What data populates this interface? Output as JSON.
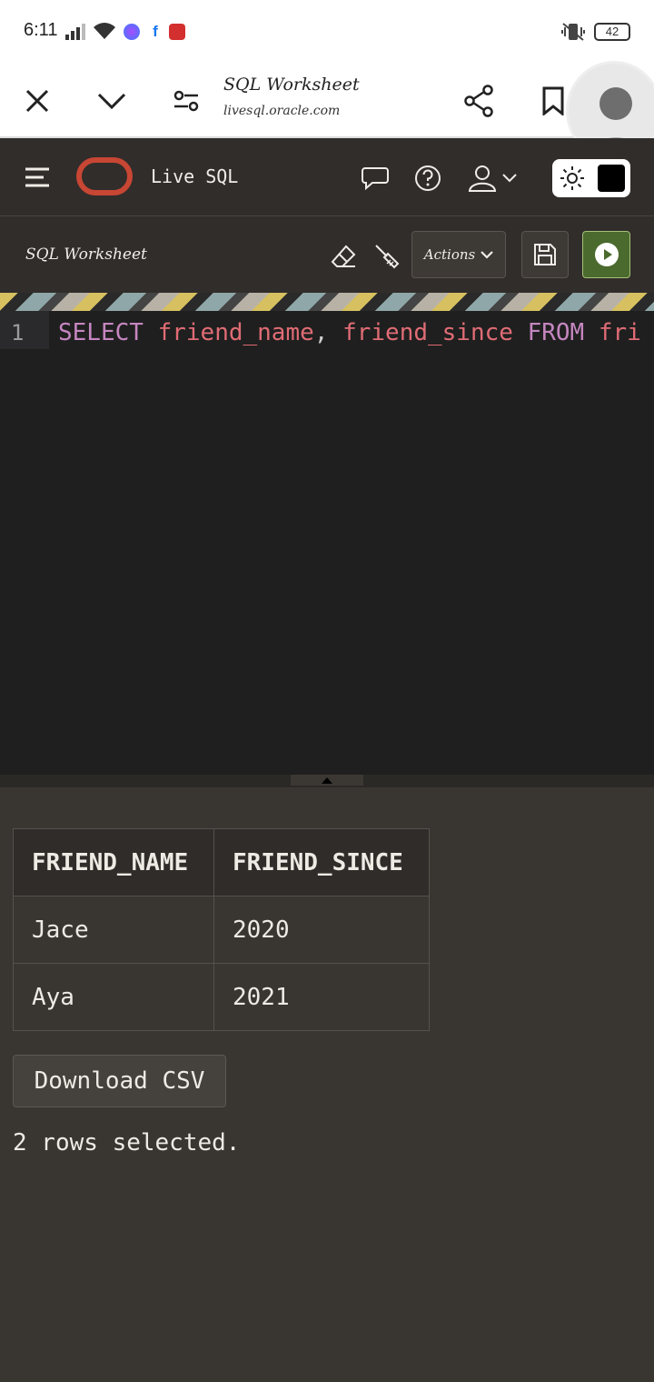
{
  "status_bar": {
    "time": "6:11",
    "battery": "42"
  },
  "browser": {
    "page_title": "SQL Worksheet",
    "url": "livesql.oracle.com"
  },
  "app": {
    "title": "Live SQL"
  },
  "worksheet": {
    "title": "SQL Worksheet",
    "actions_label": "Actions"
  },
  "editor": {
    "line_number": "1",
    "code_tokens": [
      "SELECT",
      " friend_name",
      ",",
      " friend_since",
      " FROM",
      " fri"
    ]
  },
  "results": {
    "columns": [
      "FRIEND_NAME",
      "FRIEND_SINCE"
    ],
    "rows": [
      [
        "Jace",
        "2020"
      ],
      [
        "Aya",
        "2021"
      ]
    ],
    "download_label": "Download CSV",
    "row_count_text": "2 rows selected."
  },
  "colors": {
    "brand_red": "#c74634",
    "run_green": "#4b6a2e",
    "header_bg": "#312d2a",
    "editor_bg": "#1f1f1f"
  }
}
